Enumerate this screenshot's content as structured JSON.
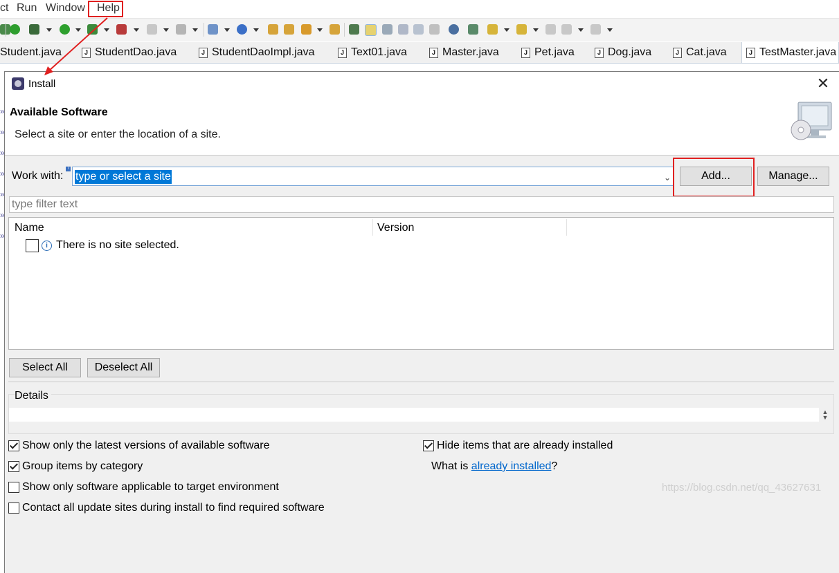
{
  "menubar": {
    "items": [
      "ct",
      "Run",
      "Window",
      "Help"
    ]
  },
  "tabs": [
    {
      "label": "Student.java",
      "active": false
    },
    {
      "label": "StudentDao.java",
      "active": false
    },
    {
      "label": "StudentDaoImpl.java",
      "active": false
    },
    {
      "label": "Text01.java",
      "active": false
    },
    {
      "label": "Master.java",
      "active": false
    },
    {
      "label": "Pet.java",
      "active": false
    },
    {
      "label": "Dog.java",
      "active": false
    },
    {
      "label": "Cat.java",
      "active": false
    },
    {
      "label": "TestMaster.java",
      "active": true
    }
  ],
  "dialog": {
    "title": "Install",
    "close": "✕",
    "section_title": "Available Software",
    "section_desc": "Select a site or enter the location of a site.",
    "work_with": {
      "label": "Work with:",
      "value": "type or select a site",
      "add_label": "Add...",
      "manage_label": "Manage..."
    },
    "filter_placeholder": "type filter text",
    "table": {
      "columns": [
        "Name",
        "Version"
      ],
      "message": "There is no site selected."
    },
    "select_all": "Select All",
    "deselect_all": "Deselect All",
    "details_label": "Details",
    "options": {
      "latest": {
        "label": "Show only the latest versions of available software",
        "checked": true
      },
      "group": {
        "label": "Group items by category",
        "checked": true
      },
      "applicable": {
        "label": "Show only software applicable to target environment",
        "checked": false
      },
      "contact": {
        "label": "Contact all update sites during install to find required software",
        "checked": false
      },
      "hide": {
        "label": "Hide items that are already installed",
        "checked": true
      }
    },
    "what_is_prefix": "What is ",
    "what_is_link": "already installed",
    "what_is_suffix": "?"
  },
  "watermark": "https://blog.csdn.net/qq_43627631",
  "colors": {
    "highlight_red": "#e02020",
    "selection_blue": "#0078d7",
    "link_blue": "#0066cc"
  }
}
